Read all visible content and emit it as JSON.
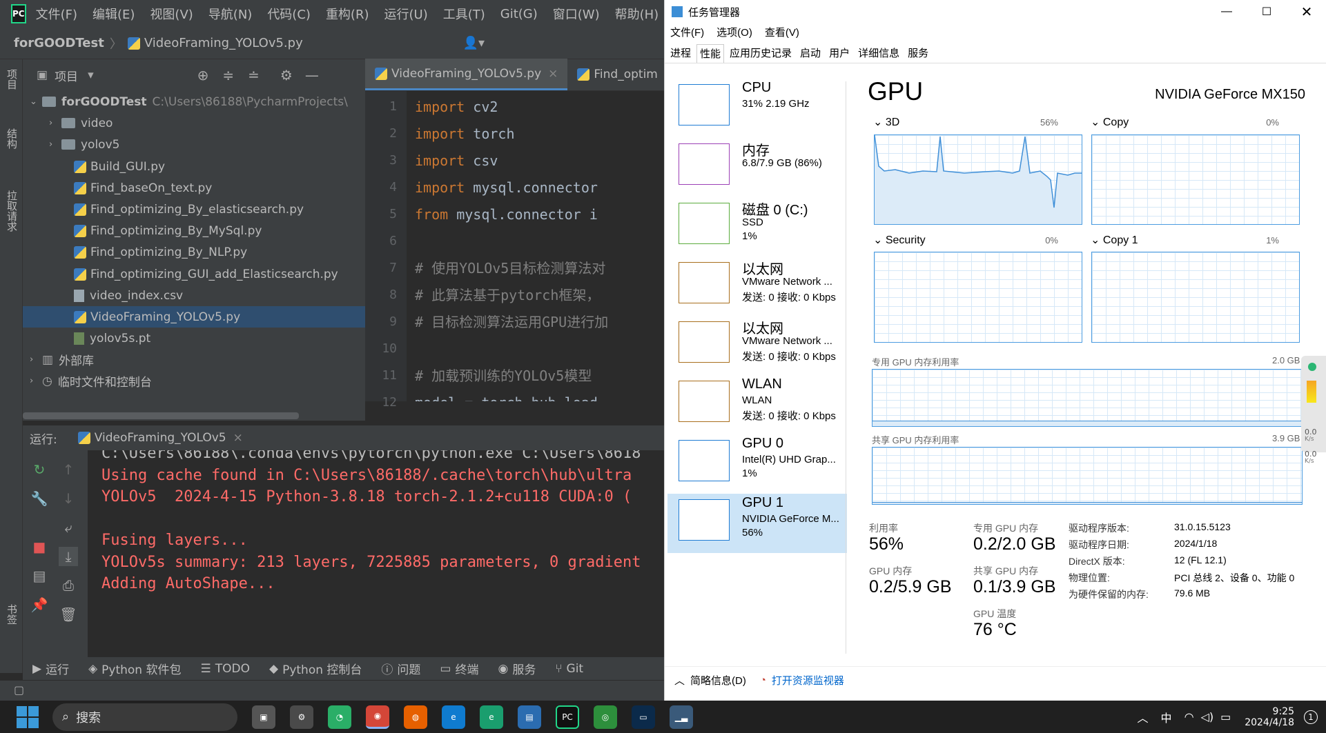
{
  "pycharm": {
    "logo": "PC",
    "menu": [
      "文件(F)",
      "编辑(E)",
      "视图(V)",
      "导航(N)",
      "代码(C)",
      "重构(R)",
      "运行(U)",
      "工具(T)",
      "Git(G)",
      "窗口(W)",
      "帮助(H)"
    ],
    "breadcrumb": {
      "project": "forGOODTest",
      "file": "VideoFraming_YOLOv5.py"
    },
    "left_strip": [
      "项目",
      "结构",
      "拉取请求",
      "书签"
    ],
    "project_panel": {
      "title": "项目",
      "root_name": "forGOODTest",
      "root_path": "C:\\Users\\86188\\PycharmProjects\\",
      "items": [
        {
          "name": "video",
          "kind": "folder"
        },
        {
          "name": "yolov5",
          "kind": "folder"
        },
        {
          "name": "Build_GUI.py",
          "kind": "py"
        },
        {
          "name": "Find_baseOn_text.py",
          "kind": "py"
        },
        {
          "name": "Find_optimizing_By_elasticsearch.py",
          "kind": "py"
        },
        {
          "name": "Find_optimizing_By_MySql.py",
          "kind": "py"
        },
        {
          "name": "Find_optimizing_By_NLP.py",
          "kind": "py"
        },
        {
          "name": "Find_optimizing_GUI_add_Elasticsearch.py",
          "kind": "py"
        },
        {
          "name": "video_index.csv",
          "kind": "csv"
        },
        {
          "name": "VideoFraming_YOLOv5.py",
          "kind": "py",
          "selected": true
        },
        {
          "name": "yolov5s.pt",
          "kind": "pt"
        }
      ],
      "external_libs": "外部库",
      "scratches": "临时文件和控制台"
    },
    "editor_tabs": [
      "VideoFraming_YOLOv5.py",
      "Find_optim"
    ],
    "code_lines": [
      {
        "n": "1",
        "kw": "import",
        "rest": " cv2"
      },
      {
        "n": "2",
        "kw": "import",
        "rest": " torch"
      },
      {
        "n": "3",
        "kw": "import",
        "rest": " csv"
      },
      {
        "n": "4",
        "kw": "import",
        "rest": " mysql.connector"
      },
      {
        "n": "5",
        "kw": "from",
        "rest": " mysql.connector i"
      },
      {
        "n": "6",
        "kw": "",
        "rest": ""
      },
      {
        "n": "7",
        "kw": "",
        "rest": "# 使用YOLOv5目标检测算法对"
      },
      {
        "n": "8",
        "kw": "",
        "rest": "# 此算法基于pytorch框架，"
      },
      {
        "n": "9",
        "kw": "",
        "rest": "# 目标检测算法运用GPU进行加"
      },
      {
        "n": "10",
        "kw": "",
        "rest": ""
      },
      {
        "n": "11",
        "kw": "",
        "rest": "# 加载预训练的YOLOv5模型"
      },
      {
        "n": "12",
        "kw": "",
        "rest": "model = torch.hub.load"
      }
    ],
    "run": {
      "label": "运行:",
      "tab": "VideoFraming_YOLOv5",
      "console": [
        "C:\\Users\\86188\\.conda\\envs\\pytorch\\python.exe C:\\Users\\8618",
        "Using cache found in C:\\Users\\86188/.cache\\torch\\hub\\ultra",
        "YOLOv5  2024-4-15 Python-3.8.18 torch-2.1.2+cu118 CUDA:0 (",
        "",
        "Fusing layers...",
        "YOLOv5s summary: 213 layers, 7225885 parameters, 0 gradient",
        "Adding AutoShape..."
      ]
    },
    "bottom_tools": [
      "运行",
      "Python 软件包",
      "TODO",
      "Python 控制台",
      "问题",
      "终端",
      "服务",
      "Git"
    ]
  },
  "taskmgr": {
    "title": "任务管理器",
    "menu": [
      "文件(F)",
      "选项(O)",
      "查看(V)"
    ],
    "tabs": [
      "进程",
      "性能",
      "应用历史记录",
      "启动",
      "用户",
      "详细信息",
      "服务"
    ],
    "active_tab": "性能",
    "sidebar": [
      {
        "title": "CPU",
        "sub1": "31% 2.19 GHz",
        "sub2": "",
        "color": "#1e7bd3"
      },
      {
        "title": "内存",
        "sub1": "6.8/7.9 GB (86%)",
        "sub2": "",
        "color": "#9b3fb5"
      },
      {
        "title": "磁盘 0 (C:)",
        "sub1": "SSD",
        "sub2": "1%",
        "color": "#5aab3c"
      },
      {
        "title": "以太网",
        "sub1": "VMware Network ...",
        "sub2": "发送: 0 接收: 0 Kbps",
        "color": "#a86e1c"
      },
      {
        "title": "以太网",
        "sub1": "VMware Network ...",
        "sub2": "发送: 0 接收: 0 Kbps",
        "color": "#a86e1c"
      },
      {
        "title": "WLAN",
        "sub1": "WLAN",
        "sub2": "发送: 0 接收: 0 Kbps",
        "color": "#a86e1c"
      },
      {
        "title": "GPU 0",
        "sub1": "Intel(R) UHD Grap...",
        "sub2": "1%",
        "color": "#1e7bd3"
      },
      {
        "title": "GPU 1",
        "sub1": "NVIDIA GeForce M...",
        "sub2": "56%",
        "color": "#1e7bd3",
        "selected": true
      }
    ],
    "gpu": {
      "heading": "GPU",
      "model": "NVIDIA GeForce MX150",
      "engines": [
        {
          "name": "3D",
          "pct": "56%"
        },
        {
          "name": "Copy",
          "pct": "0%"
        },
        {
          "name": "Security",
          "pct": "0%"
        },
        {
          "name": "Copy 1",
          "pct": "1%"
        }
      ],
      "dedicated_label": "专用 GPU 内存利用率",
      "dedicated_max": "2.0 GB",
      "shared_label": "共享 GPU 内存利用率",
      "shared_max": "3.9 GB",
      "stats": {
        "util_label": "利用率",
        "util": "56%",
        "ded_label": "专用 GPU 内存",
        "ded": "0.2/2.0 GB",
        "gpumem_label": "GPU 内存",
        "gpumem": "0.2/5.9 GB",
        "shr_label": "共享 GPU 内存",
        "shr": "0.1/3.9 GB",
        "temp_label": "GPU 温度",
        "temp": "76 °C"
      },
      "details": [
        {
          "k": "驱动程序版本:",
          "v": "31.0.15.5123"
        },
        {
          "k": "驱动程序日期:",
          "v": "2024/1/18"
        },
        {
          "k": "DirectX 版本:",
          "v": "12 (FL 12.1)"
        },
        {
          "k": "物理位置:",
          "v": "PCI 总线 2、设备 0、功能 0"
        },
        {
          "k": "为硬件保留的内存:",
          "v": "79.6 MB"
        }
      ]
    },
    "footer": {
      "brief": "简略信息(D)",
      "monitor": "打开资源监视器"
    },
    "side_handle": [
      "0.0",
      "K/s",
      "0.0",
      "K/s"
    ]
  },
  "taskbar": {
    "search": "搜索",
    "ime": "中",
    "time": "9:25",
    "date": "2024/4/18",
    "notif": "1"
  }
}
